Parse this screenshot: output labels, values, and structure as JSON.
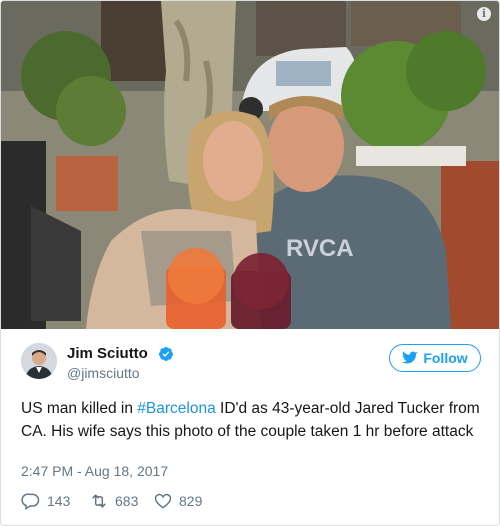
{
  "tweet": {
    "author_name": "Jim Sciutto",
    "author_handle": "@jimsciutto",
    "follow_label": "Follow",
    "text_before": "US man killed in ",
    "hashtag": "#Barcelona",
    "text_after": " ID'd as 43-year-old Jared Tucker from CA. His wife says this photo of the couple taken 1 hr before attack",
    "timestamp": "2:47 PM - Aug 18, 2017",
    "replies": "143",
    "retweets": "683",
    "likes": "829"
  },
  "photo": {
    "shirt_text": "RVCA"
  },
  "icons": {
    "verified": "verified-badge-icon",
    "follow": "twitter-bird-icon",
    "reply": "reply-icon",
    "retweet": "retweet-icon",
    "like": "heart-icon",
    "info": "info-icon"
  },
  "colors": {
    "accent": "#1da1f2",
    "hashtag": "#1b95e0",
    "muted": "#657786",
    "text": "#14171a"
  }
}
